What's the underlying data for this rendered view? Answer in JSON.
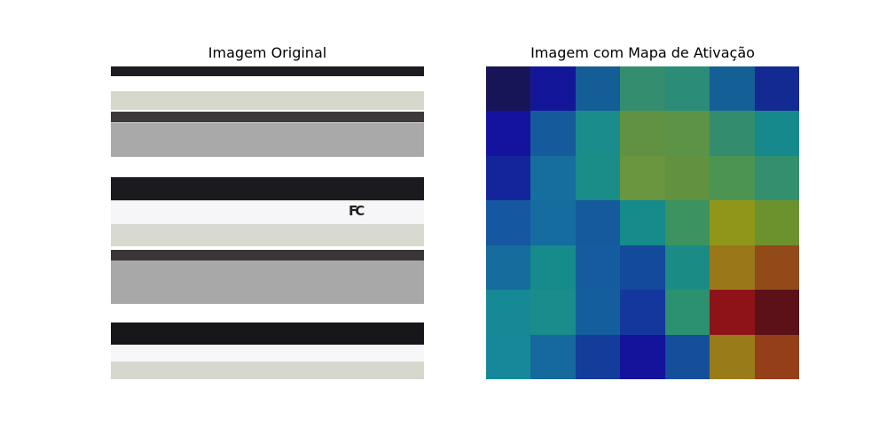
{
  "panels": {
    "left_title": "Imagem Original",
    "right_title": "Imagem com Mapa de Ativação"
  },
  "left_image": {
    "content": "horizontal striped fabric",
    "logo_text": "FC",
    "stripes": [
      {
        "color": "#1c1c22",
        "fraction_top": 0.0,
        "fraction_h": 0.03
      },
      {
        "color": "#ffffff",
        "fraction_top": 0.03,
        "fraction_h": 0.05
      },
      {
        "color": "#d6d8cc",
        "fraction_top": 0.08,
        "fraction_h": 0.06
      },
      {
        "color": "#ffffff",
        "fraction_top": 0.14,
        "fraction_h": 0.005
      },
      {
        "color": "#3d3839",
        "fraction_top": 0.145,
        "fraction_h": 0.035
      },
      {
        "color": "#a9a9a9",
        "fraction_top": 0.18,
        "fraction_h": 0.11
      },
      {
        "color": "#ffffff",
        "fraction_top": 0.29,
        "fraction_h": 0.065
      },
      {
        "color": "#1a1a1f",
        "fraction_top": 0.355,
        "fraction_h": 0.075
      },
      {
        "color": "#f6f6f8",
        "fraction_top": 0.43,
        "fraction_h": 0.075
      },
      {
        "color": "#d8d9cf",
        "fraction_top": 0.505,
        "fraction_h": 0.07
      },
      {
        "color": "#ffffff",
        "fraction_top": 0.575,
        "fraction_h": 0.01
      },
      {
        "color": "#3a3536",
        "fraction_top": 0.585,
        "fraction_h": 0.035
      },
      {
        "color": "#a8a8a8",
        "fraction_top": 0.62,
        "fraction_h": 0.14
      },
      {
        "color": "#ffffff",
        "fraction_top": 0.76,
        "fraction_h": 0.06
      },
      {
        "color": "#16161b",
        "fraction_top": 0.82,
        "fraction_h": 0.07
      },
      {
        "color": "#f7f7f8",
        "fraction_top": 0.89,
        "fraction_h": 0.055
      },
      {
        "color": "#d6d7cd",
        "fraction_top": 0.945,
        "fraction_h": 0.055
      }
    ]
  },
  "activation_map": {
    "rows": 7,
    "cols": 7,
    "colors": [
      [
        "#171557",
        "#14169a",
        "#145d97",
        "#348d6e",
        "#2b8c78",
        "#155f97",
        "#142a93"
      ],
      [
        "#1413a0",
        "#155b9c",
        "#1a8c8c",
        "#609242",
        "#5c9346",
        "#338c6e",
        "#15898c"
      ],
      [
        "#14259c",
        "#156e9d",
        "#1a8d88",
        "#6a9640",
        "#62923f",
        "#4b9452",
        "#338f6d"
      ],
      [
        "#1557a0",
        "#146d9e",
        "#145a9d",
        "#158b8c",
        "#3c9360",
        "#8f9619",
        "#6b922d"
      ],
      [
        "#156c9d",
        "#158b8c",
        "#155c9e",
        "#144a9b",
        "#1a8c85",
        "#9a7719",
        "#924a19"
      ],
      [
        "#158a96",
        "#1a8c8b",
        "#155e9d",
        "#14379d",
        "#2b9170",
        "#8e1318",
        "#5b1117"
      ],
      [
        "#15899a",
        "#15699d",
        "#143c9a",
        "#13139c",
        "#154f9b",
        "#9a7b1a",
        "#943f19"
      ]
    ]
  }
}
